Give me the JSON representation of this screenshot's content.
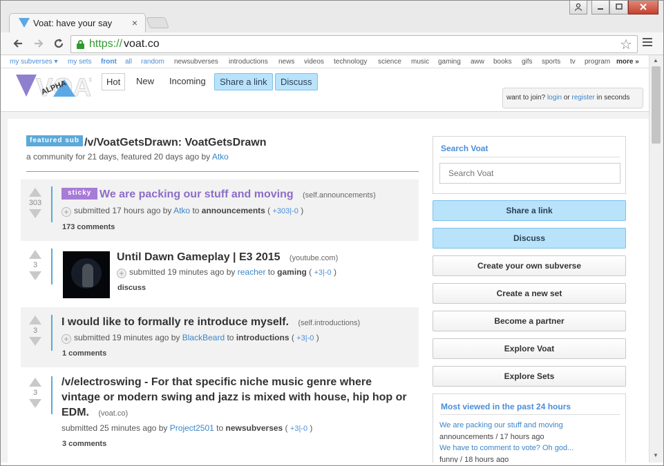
{
  "browser": {
    "tab_title": "Voat: have your say",
    "tab_close": "×",
    "url_scheme": "https://",
    "url_host": "voat.co",
    "back_icon": "arrow-left-icon",
    "forward_icon": "arrow-right-icon",
    "reload_icon": "reload-icon",
    "bookmark_icon": "star-icon",
    "menu_icon": "hamburger-icon",
    "window_buttons": [
      "user",
      "minimize",
      "maximize",
      "close"
    ]
  },
  "subverse_menu": [
    "my subverses ▾",
    "my sets",
    "front",
    "all",
    "random",
    "newsubverses",
    "introductions",
    "news",
    "videos",
    "technology",
    "science",
    "music",
    "gaming",
    "aww",
    "books",
    "gifs",
    "sports",
    "tv",
    "program",
    "more »"
  ],
  "header": {
    "logo_letters": "VOAT",
    "logo_badge": "ALPHA",
    "tabs": [
      "Hot",
      "New",
      "Incoming"
    ],
    "buttons": [
      "Share a link",
      "Discuss"
    ],
    "join_prefix": "want to join? ",
    "join_login": "login",
    "join_or": " or ",
    "join_register": "register",
    "join_suffix": " in seconds"
  },
  "featured": {
    "badge": "featured sub",
    "title": "/v/VoatGetsDrawn: VoatGetsDrawn",
    "subtitle_prefix": "a community for 21 days, featured 20 days ago by ",
    "subtitle_user": "Atko"
  },
  "posts": [
    {
      "score": "303",
      "sticky": "sticky",
      "title": "We are packing our stuff and moving",
      "domain": "(self.announcements)",
      "submitted": "submitted 17 hours ago by ",
      "user": "Atko",
      "to": " to ",
      "sub": "announcements",
      "open": " ( ",
      "plus": "+303",
      "sep": "|",
      "minus": "-0",
      "close": " )",
      "comments": "173 comments"
    },
    {
      "score": "3",
      "title": "Until Dawn Gameplay | E3 2015",
      "domain": "(youtube.com)",
      "submitted": "submitted 19 minutes ago by ",
      "user": "reacher",
      "to": " to ",
      "sub": "gaming",
      "open": " ( ",
      "plus": "+3",
      "sep": "|",
      "minus": "-0",
      "close": " )",
      "comments": "discuss"
    },
    {
      "score": "3",
      "title": "I would like to formally re introduce myself.",
      "domain": "(self.introductions)",
      "submitted": "submitted 19 minutes ago by ",
      "user": "BlackBeard",
      "to": " to ",
      "sub": "introductions",
      "open": " ( ",
      "plus": "+3",
      "sep": "|",
      "minus": "-0",
      "close": " )",
      "comments": "1 comments"
    },
    {
      "score": "3",
      "title_line1": "/v/electroswing - For that specific niche music genre where",
      "title_line2": "vintage or modern swing and jazz is mixed with house, hip hop or",
      "title_line3": "EDM.",
      "domain": "(voat.co)",
      "submitted": "submitted 25 minutes ago by ",
      "user": "Project2501",
      "to": " to ",
      "sub": "newsubverses",
      "open": " ( ",
      "plus": "+3",
      "sep": "|",
      "minus": "-0",
      "close": " )",
      "comments": "3 comments"
    }
  ],
  "sidebar": {
    "search_title": "Search Voat",
    "search_placeholder": "Search Voat",
    "buttons": [
      "Share a link",
      "Discuss",
      "Create your own subverse",
      "Create a new set",
      "Become a partner",
      "Explore Voat",
      "Explore Sets"
    ],
    "most_viewed_title": "Most viewed in the past 24 hours",
    "most_viewed": [
      {
        "title": "We are packing our stuff and moving",
        "meta": "announcements / 17 hours ago"
      },
      {
        "title": "We have to comment to vote? Oh god...",
        "meta": "funny / 18 hours ago"
      }
    ]
  }
}
